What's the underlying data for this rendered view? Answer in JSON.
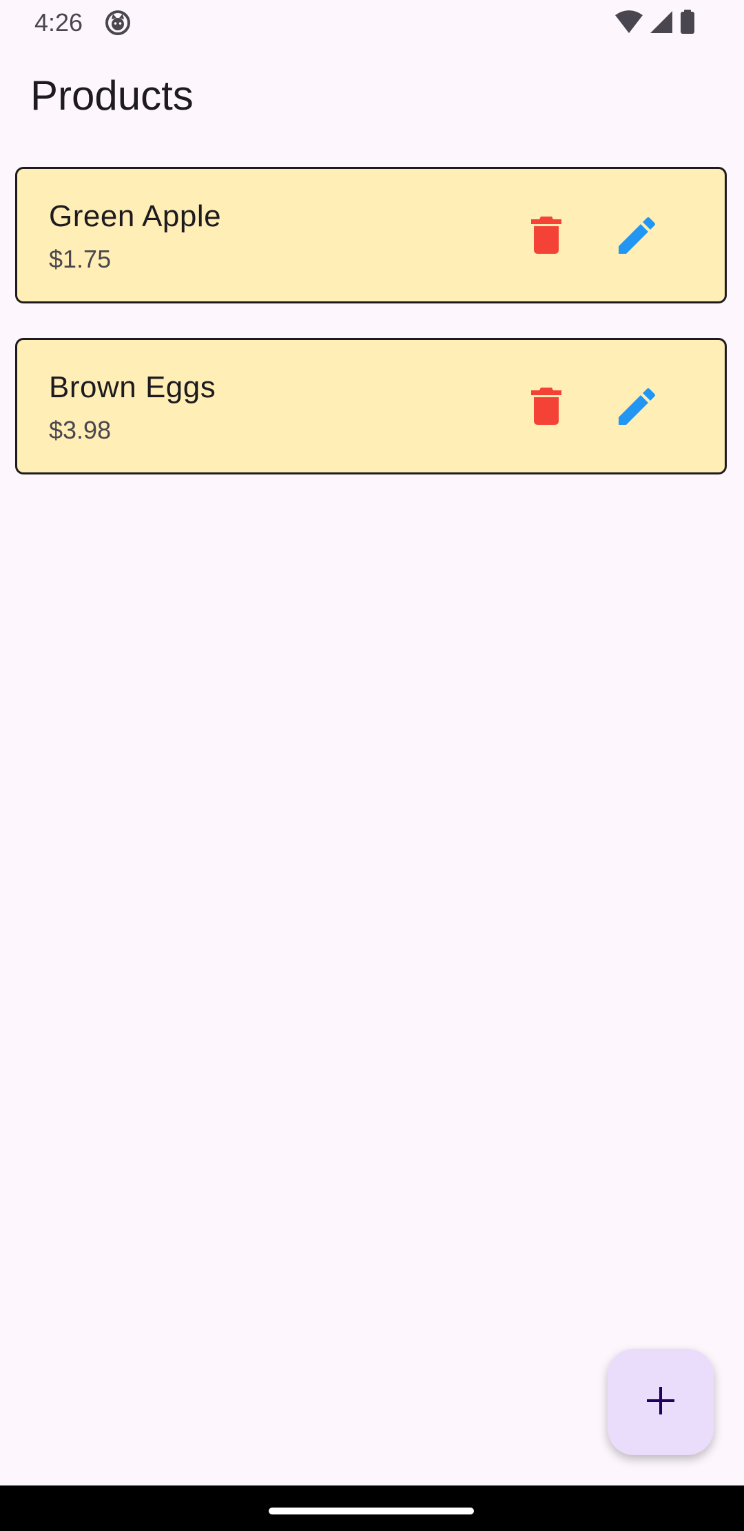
{
  "status_bar": {
    "time": "4:26"
  },
  "app_bar": {
    "title": "Products"
  },
  "products": [
    {
      "name": "Green Apple",
      "price": "$1.75"
    },
    {
      "name": "Brown Eggs",
      "price": "$3.98"
    }
  ],
  "colors": {
    "background": "#fdf7fd",
    "card": "#ffeeb5",
    "delete": "#f44336",
    "edit": "#2196f3",
    "fab": "#eadcfb",
    "fab_icon": "#21005d"
  },
  "icons": {
    "delete": "trash-icon",
    "edit": "pencil-icon",
    "fab": "plus-icon"
  }
}
